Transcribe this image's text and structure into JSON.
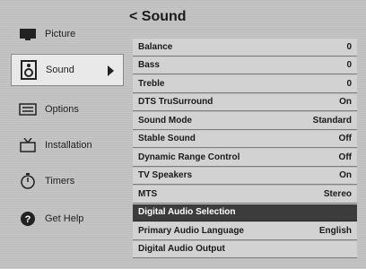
{
  "nav": {
    "items": [
      {
        "label": "Picture",
        "icon": "tv-icon",
        "active": false
      },
      {
        "label": "Sound",
        "icon": "speaker-icon",
        "active": true
      },
      {
        "label": "Options",
        "icon": "options-icon",
        "active": false
      },
      {
        "label": "Installation",
        "icon": "installation-icon",
        "active": false
      },
      {
        "label": "Timers",
        "icon": "timer-icon",
        "active": false
      },
      {
        "label": "Get Help",
        "icon": "help-icon",
        "active": false
      }
    ]
  },
  "panel": {
    "title": "< Sound",
    "rows": [
      {
        "label": "Balance",
        "value": "0"
      },
      {
        "label": "Bass",
        "value": "0"
      },
      {
        "label": "Treble",
        "value": "0"
      },
      {
        "label": "DTS TruSurround",
        "value": "On"
      },
      {
        "label": "Sound Mode",
        "value": "Standard"
      },
      {
        "label": "Stable Sound",
        "value": "Off"
      },
      {
        "label": "Dynamic Range Control",
        "value": "Off"
      },
      {
        "label": "TV Speakers",
        "value": "On"
      },
      {
        "label": "MTS",
        "value": "Stereo"
      },
      {
        "label": "Digital Audio Selection",
        "value": ""
      },
      {
        "label": "Primary Audio Language",
        "value": "English"
      },
      {
        "label": "Digital Audio Output",
        "value": ""
      }
    ],
    "selected_index": 9
  },
  "colors": {
    "background": "#c4c4c4",
    "row": "#d2d2d2",
    "selected_row": "#3c3c3c"
  }
}
